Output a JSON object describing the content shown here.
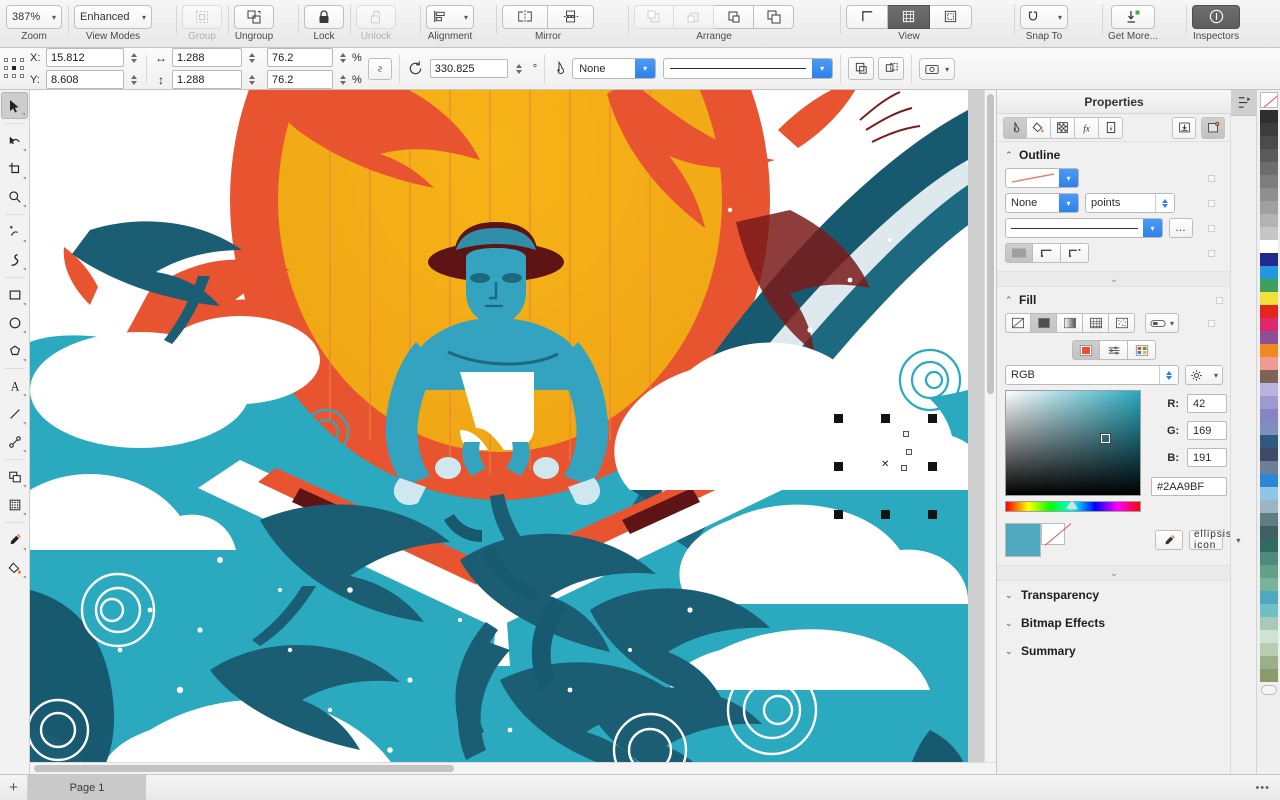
{
  "ribbon": {
    "groups": [
      {
        "label": "Zoom",
        "items": [
          {
            "name": "zoom-level-dropdown",
            "label": "387%",
            "icon": "chevron-down-icon"
          }
        ]
      },
      {
        "label": "View Modes",
        "items": [
          {
            "name": "view-mode-dropdown",
            "label": "Enhanced",
            "icon": "chevron-down-icon"
          }
        ]
      },
      {
        "label": "Group",
        "dim": true,
        "items": [
          {
            "name": "group-button",
            "label": "",
            "icon": "group-icon"
          }
        ]
      },
      {
        "label": "Ungroup",
        "dim": false,
        "items": [
          {
            "name": "ungroup-button",
            "label": "",
            "icon": "ungroup-icon"
          }
        ]
      },
      {
        "label": "Lock",
        "items": [
          {
            "name": "lock-button",
            "label": "",
            "icon": "lock-closed-icon"
          }
        ]
      },
      {
        "label": "Unlock",
        "dim": true,
        "items": [
          {
            "name": "unlock-button",
            "label": "",
            "icon": "lock-open-icon"
          }
        ]
      },
      {
        "label": "Alignment",
        "items": [
          {
            "name": "alignment-dropdown",
            "label": "",
            "icon": "align-left-icon"
          }
        ]
      },
      {
        "label": "Mirror",
        "items": [
          {
            "name": "mirror-horizontal-button",
            "icon": "mirror-horizontal-icon"
          },
          {
            "name": "mirror-vertical-button",
            "icon": "mirror-vertical-icon"
          }
        ]
      },
      {
        "label": "Arrange",
        "items": [
          {
            "name": "bring-to-front-button",
            "icon": "bring-to-front-icon",
            "dim": true
          },
          {
            "name": "bring-forward-button",
            "icon": "bring-forward-icon",
            "dim": true
          },
          {
            "name": "send-backward-button",
            "icon": "send-backward-icon"
          },
          {
            "name": "send-to-back-button",
            "icon": "send-to-back-icon"
          }
        ]
      },
      {
        "label": "View",
        "items": [
          {
            "name": "guides-button",
            "icon": "guides-icon"
          },
          {
            "name": "grid-button",
            "icon": "grid-icon",
            "active": true
          },
          {
            "name": "page-border-button",
            "icon": "page-border-icon"
          }
        ]
      },
      {
        "label": "Snap To",
        "items": [
          {
            "name": "snap-to-dropdown",
            "icon": "magnet-icon"
          }
        ]
      },
      {
        "label": "Get More...",
        "items": [
          {
            "name": "get-more-button",
            "icon": "download-plus-icon"
          }
        ]
      },
      {
        "label": "Inspectors",
        "items": [
          {
            "name": "inspectors-button",
            "icon": "info-circle-icon",
            "active": true
          }
        ]
      }
    ]
  },
  "propbar": {
    "x_label": "X:",
    "x_value": "15.812",
    "y_label": "Y:",
    "y_value": "8.608",
    "width_value": "1.288",
    "height_value": "1.288",
    "width_percent": "76.2",
    "height_percent": "76.2",
    "percent_symbol": "%",
    "lock_ratio_icon": "link-ratio-icon",
    "rotate_icon": "rotate-icon",
    "rotate_value": "330.825",
    "degree_symbol": "°",
    "outline_icon": "pen-nib-icon",
    "outline_width_value": "None",
    "line_style_value": "solid-line",
    "combine_icon": "combine-icon",
    "break_apart_icon": "break-apart-icon",
    "camera_icon": "camera-icon"
  },
  "tools": [
    {
      "name": "tool-selector",
      "icon": "arrow-pointer-icon",
      "selected": true
    },
    {
      "name": "tool-shape-edit",
      "icon": "node-edit-icon"
    },
    {
      "name": "tool-crop",
      "icon": "crop-icon"
    },
    {
      "name": "tool-zoom",
      "icon": "magnifier-icon"
    },
    {
      "name": "tool-pen",
      "icon": "pen-add-icon"
    },
    {
      "name": "tool-freehand",
      "icon": "freehand-curve-icon"
    },
    {
      "name": "tool-rectangle",
      "icon": "rectangle-icon"
    },
    {
      "name": "tool-ellipse",
      "icon": "ellipse-icon"
    },
    {
      "name": "tool-polygon",
      "icon": "polygon-icon"
    },
    {
      "name": "tool-text",
      "icon": "text-a-icon"
    },
    {
      "name": "tool-line",
      "icon": "line-icon"
    },
    {
      "name": "tool-connector",
      "icon": "connector-icon"
    },
    {
      "name": "tool-blend",
      "icon": "blend-shapes-icon"
    },
    {
      "name": "tool-halftone",
      "icon": "halftone-grid-icon"
    },
    {
      "name": "tool-eyedropper",
      "icon": "eyedropper-icon"
    },
    {
      "name": "tool-fill",
      "icon": "paint-bucket-icon"
    }
  ],
  "inspector": {
    "title": "Properties",
    "close_icon": "close-icon",
    "tabs": [
      {
        "name": "tab-outline",
        "icon": "pen-nib-icon",
        "active": true
      },
      {
        "name": "tab-fill",
        "icon": "paint-bucket-icon"
      },
      {
        "name": "tab-transparency",
        "icon": "checker-icon"
      },
      {
        "name": "tab-effects",
        "icon": "fx-icon"
      },
      {
        "name": "tab-info",
        "icon": "document-info-icon"
      }
    ],
    "actions": [
      {
        "name": "import-preset-button",
        "icon": "import-box-icon"
      },
      {
        "name": "new-style-button",
        "icon": "new-page-icon",
        "active": true
      }
    ],
    "rail_icon": "object-manager-icon",
    "outline": {
      "title": "Outline",
      "chevron": "chevron-up-icon",
      "color_preview": "stroke-color-preview",
      "width_value": "None",
      "units_value": "points",
      "style_preview": "solid-line",
      "more_label": "…",
      "corner_buttons": [
        {
          "name": "corner-miter-button",
          "active": true
        },
        {
          "name": "corner-round-button"
        },
        {
          "name": "corner-bevel-button"
        }
      ]
    },
    "fill": {
      "title": "Fill",
      "chevron": "chevron-up-icon",
      "types": [
        {
          "name": "fill-none-button",
          "icon": "no-fill-icon"
        },
        {
          "name": "fill-solid-button",
          "icon": "solid-fill-icon",
          "active": true
        },
        {
          "name": "fill-gradient-button",
          "icon": "gradient-fill-icon"
        },
        {
          "name": "fill-pattern-button",
          "icon": "pattern-fill-icon"
        },
        {
          "name": "fill-texture-button",
          "icon": "texture-fill-icon"
        }
      ],
      "winding_icon": "fill-rule-icon",
      "picker_modes": [
        {
          "name": "picker-visual-button",
          "icon": "color-square-icon",
          "active": true
        },
        {
          "name": "picker-sliders-button",
          "icon": "sliders-icon"
        },
        {
          "name": "picker-palette-button",
          "icon": "palette-grid-icon"
        }
      ],
      "color_model": "RGB",
      "settings_icon": "gear-icon",
      "r_label": "R:",
      "r_value": "42",
      "g_label": "G:",
      "g_value": "169",
      "b_label": "B:",
      "b_value": "191",
      "hex_value": "#2AA9BF",
      "current_swatch_color": "#4fa8bf",
      "eyedropper_icon": "eyedropper-icon",
      "more_icon": "ellipsis-icon"
    },
    "sections": [
      {
        "name": "section-transparency",
        "title": "Transparency",
        "chevron": "chevron-down-icon"
      },
      {
        "name": "section-bitmap-effects",
        "title": "Bitmap Effects",
        "chevron": "chevron-down-icon"
      },
      {
        "name": "section-summary",
        "title": "Summary",
        "chevron": "chevron-down-icon"
      }
    ]
  },
  "palette": {
    "none_swatch": "no-color-swatch",
    "colors": [
      "#2e2e2e",
      "#3c3c3c",
      "#4b4b4b",
      "#5a5a5a",
      "#6d6d6d",
      "#7e7e7e",
      "#8f8f8f",
      "#a0a0a0",
      "#b3b3b3",
      "#c6c6c6",
      "#ffffff",
      "#232a8e",
      "#2196e3",
      "#3f9f5e",
      "#f2e03a",
      "#e1251f",
      "#e0276d",
      "#8e4f96",
      "#f08a1e",
      "#ef9a93",
      "#7d6457",
      "#b9b3dd",
      "#9c9ad0",
      "#8684c4",
      "#7f8ebf",
      "#2e5a80",
      "#3f4a6b",
      "#6b7f96",
      "#2b86d6",
      "#8fc6e8",
      "#9db5c0",
      "#5f7d85",
      "#3f5f63",
      "#2f6b63",
      "#4f8a7c",
      "#63a089",
      "#79b39b",
      "#4fa8bf",
      "#6fbfc6",
      "#a9c9bb",
      "#cde3d4",
      "#b6cdb0",
      "#9ab08a",
      "#8a9a6a"
    ],
    "scroll_icon": "palette-scroll-icon"
  },
  "status": {
    "add_page_label": "+",
    "page_tab_label": "Page 1",
    "overflow_label": "•••"
  },
  "canvas": {
    "selection": {
      "name": "selected-ripple-object",
      "handle_count": 8,
      "center_marker": "rotation-center-marker"
    }
  }
}
